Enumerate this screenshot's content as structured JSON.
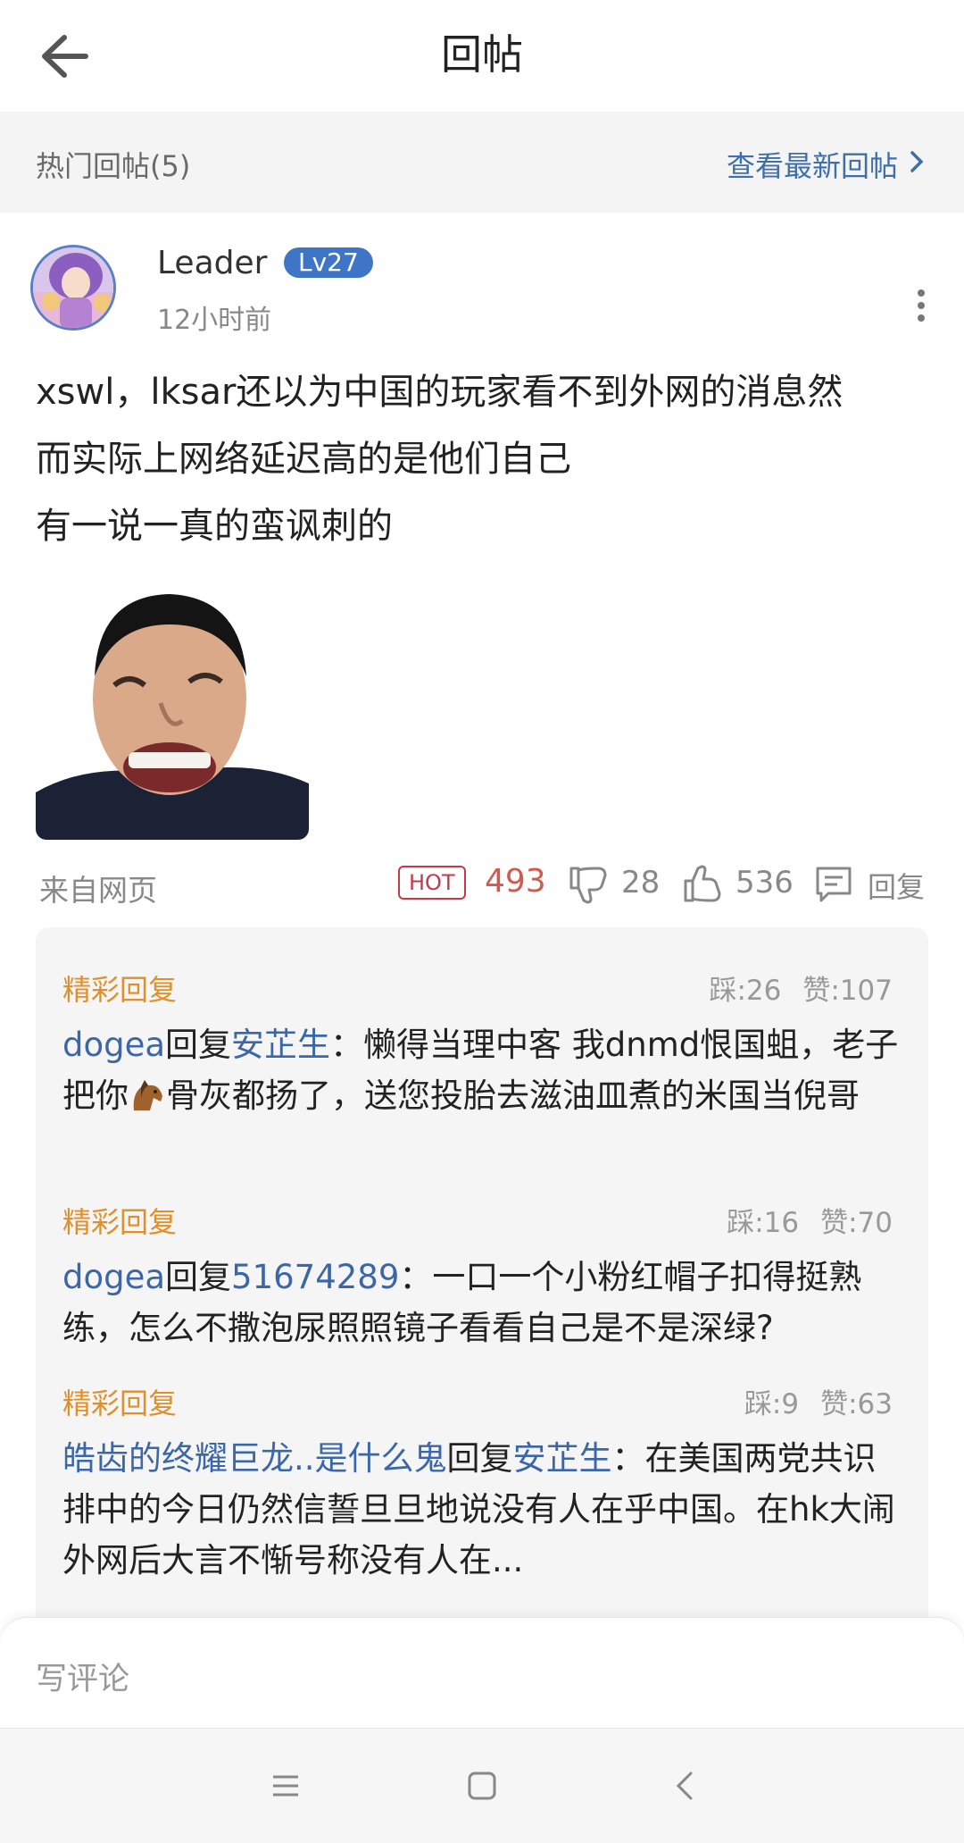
{
  "header": {
    "title": "回帖"
  },
  "hot_section": {
    "title": "热门回帖(5)",
    "latest_link": "查看最新回帖"
  },
  "post": {
    "username": "Leader",
    "level": "Lv27",
    "time": "12小时前",
    "lines": [
      "xswl，lksar还以为中国的玩家看不到外网的消息然",
      "而实际上网络延迟高的是他们自己",
      "有一说一真的蛮讽刺的"
    ],
    "source": "来自网页",
    "hot_badge": "HOT",
    "hot_count": "493",
    "dislike_count": "28",
    "like_count": "536",
    "reply_label": "回复"
  },
  "replies": [
    {
      "tag": "精彩回复",
      "dislikes": "踩:26",
      "likes": "赞:107",
      "author": "dogea",
      "reply_word": "回复",
      "target": "安芷生",
      "text_a": "：懒得当理中客 我dnmd恨国蛆，老子把你",
      "text_b": "骨灰都扬了，送您投胎去滋油皿煮的米国当倪哥"
    },
    {
      "tag": "精彩回复",
      "dislikes": "踩:16",
      "likes": "赞:70",
      "author": "dogea",
      "reply_word": "回复",
      "target": "51674289",
      "text": "：一口一个小粉红帽子扣得挺熟练，怎么不撒泡尿照照镜子看看自己是不是深绿?"
    },
    {
      "tag": "精彩回复",
      "dislikes": "踩:9",
      "likes": "赞:63",
      "author": "皓齿的终耀巨龙..是什么鬼",
      "reply_word": "回复",
      "target": "安芷生",
      "text": "：在美国两党共识排中的今日仍然信誓旦旦地说没有人在乎中国。在hk大闹外网后大言不惭号称没有人在..."
    }
  ],
  "comment": {
    "placeholder": "写评论"
  },
  "colors": {
    "accent_blue": "#3f75c7",
    "hot_red": "#c7384a",
    "reply_orange": "#e0902a"
  }
}
